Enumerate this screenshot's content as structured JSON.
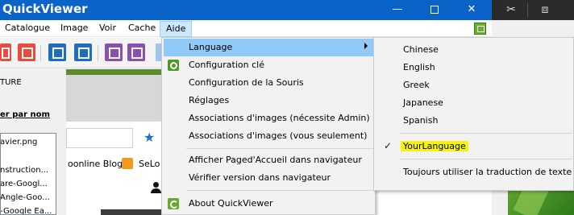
{
  "window": {
    "title": "QuickViewer",
    "minimize": "—",
    "close": "✕"
  },
  "browser_strip": {
    "scissors": "✂",
    "frame": "⧈"
  },
  "menubar": {
    "items": [
      "Catalogue",
      "Image",
      "Voir",
      "Cache",
      "Aide"
    ],
    "active": "Aide"
  },
  "left_panel": {
    "label": "TURE",
    "sort_link": "er par nom",
    "files": [
      "avier.png",
      "nstruction...",
      "are-Googl...",
      "Angle-Goo...",
      "-Google Ea..."
    ]
  },
  "background_page": {
    "link1": "oonline Blog",
    "link2": "SeLo"
  },
  "aide_menu": {
    "items": [
      {
        "label": "Language",
        "icon": "",
        "submenu": true,
        "highlight": true
      },
      {
        "label": "Configuration clé",
        "icon": "key-icon"
      },
      {
        "label": "Configuration de la Souris",
        "icon": ""
      },
      {
        "label": "Réglages",
        "icon": ""
      },
      {
        "label": "Associations d'images (nécessite Admin)",
        "icon": ""
      },
      {
        "label": "Associations d'images (vous seulement)",
        "icon": ""
      },
      {
        "label": "Afficher Paged'Accueil dans navigateur",
        "icon": ""
      },
      {
        "label": "Vérifier version dans navigateur",
        "icon": ""
      },
      {
        "label": "About QuickViewer",
        "icon": "about-icon"
      }
    ]
  },
  "language_submenu": {
    "items": [
      "Chinese",
      "English",
      "Greek",
      "Japanese",
      "Spanish",
      "YourLanguage",
      "Toujours utiliser la traduction de texte"
    ],
    "checked": "YourLanguage",
    "check_glyph": "✓"
  },
  "colors": {
    "titlebar": "#0a63c7",
    "menu_highlight": "#91c9f7",
    "checked_highlight": "#f7f30a"
  }
}
